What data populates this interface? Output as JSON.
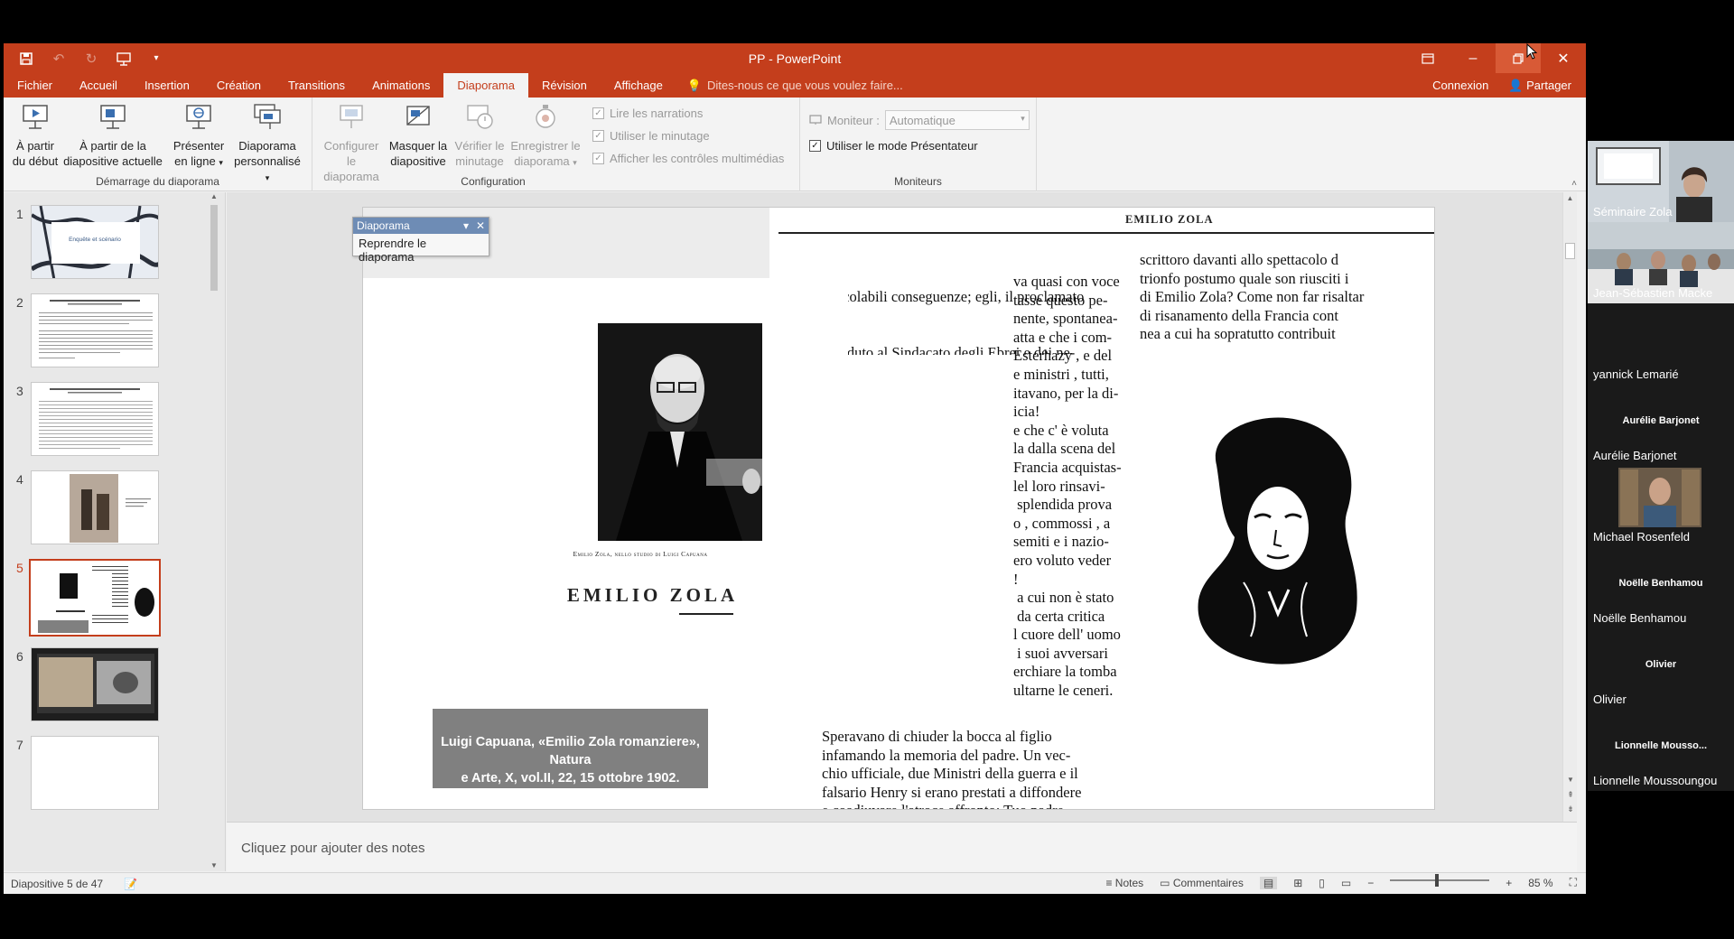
{
  "window": {
    "title": "PP - PowerPoint",
    "colors": {
      "accent": "#c43e1c",
      "ribbon_bg": "#f3f3f3",
      "call_bg": "#1a1a1a"
    }
  },
  "tabs": [
    "Fichier",
    "Accueil",
    "Insertion",
    "Création",
    "Transitions",
    "Animations",
    "Diaporama",
    "Révision",
    "Affichage"
  ],
  "active_tab": "Diaporama",
  "tell_me": "Dites-nous ce que vous voulez faire...",
  "account": {
    "signin": "Connexion",
    "share": "Partager"
  },
  "ribbon": {
    "start_group": {
      "label": "Démarrage du diaporama",
      "from_start": [
        "À partir",
        "du début"
      ],
      "from_current": [
        "À partir de la",
        "diapositive actuelle"
      ],
      "present_online": [
        "Présenter",
        "en ligne"
      ],
      "custom_show": [
        "Diaporama",
        "personnalisé"
      ]
    },
    "config_group": {
      "label": "Configuration",
      "setup": [
        "Configurer",
        "le diaporama"
      ],
      "hide_slide": [
        "Masquer la",
        "diapositive"
      ],
      "rehearse": [
        "Vérifier le",
        "minutage"
      ],
      "record": [
        "Enregistrer le",
        "diaporama"
      ],
      "play_narrations": "Lire les narrations",
      "use_timings": "Utiliser le minutage",
      "show_media_controls": "Afficher les contrôles multimédias"
    },
    "monitors_group": {
      "label": "Moniteurs",
      "monitor_label": "Moniteur :",
      "monitor_value": "Automatique",
      "presenter_view": "Utiliser le mode Présentateur"
    }
  },
  "floating_toolbar": {
    "title": "Diaporama",
    "item": "Reprendre le diaporama"
  },
  "thumbnails": [
    {
      "num": "1",
      "text": "Enquête et scénario"
    },
    {
      "num": "2",
      "text": ""
    },
    {
      "num": "3",
      "text": ""
    },
    {
      "num": "4",
      "text": ""
    },
    {
      "num": "5",
      "text": ""
    },
    {
      "num": "6",
      "text": ""
    },
    {
      "num": "7",
      "text": ""
    }
  ],
  "active_slide": "5",
  "slide": {
    "header": "EMILIO ZOLA",
    "portrait_caption": "Emilio Zola, nello studio di Luigi Capuana",
    "big_title": "EMILIO ZOLA",
    "caption_line1": "Luigi Capuana, «Emilio Zola romanziere», Natura",
    "caption_line2": "e Arte, X, vol.II, 22, 15 ottobre 1902.",
    "col_a_top": [
      "calcolabili conseguenze; egli, il proclamato",
      "venduto al Sindacato degli Ebrei e dei ne-"
    ],
    "col_a_right": [
      "va quasi con voce",
      "tasse questo pe-",
      "nente, spontanea-",
      "atta e che i com-",
      "Esterhazy , e del",
      "e ministri , tutti,",
      "itavano, per la di-",
      "icia!",
      "e che c' è voluta",
      "la dalla scena del",
      "Francia acquistas-",
      "lel loro rinsavi-",
      " splendida prova",
      "o , commossi , a",
      "semiti e i nazio-",
      "ero voluto veder",
      "!",
      " a cui non è stato",
      " da certa critica",
      "l cuore dell' uomo",
      " i suoi avversari",
      "erchiare la tomba",
      "ultarne le ceneri."
    ],
    "col_a_bottom": [
      "Speravano di chiuder la bocca al figlio",
      "infamando la memoria del padre. Un vec-",
      "chio ufficiale, due Ministri della guerra e il",
      "falsario Henry si erano prestati a diffondere",
      "e coadiuvare l'atroce affronto: Tuo padre"
    ],
    "col_b": [
      "scrittoro davanti allo spettacolo d",
      "trionfo postumo quale son riusciti i",
      "di Emilio Zola? Come non far risaltar",
      "di risanamento della Francia cont",
      "nea a cui ha sopratutto contribuit"
    ]
  },
  "notes_placeholder": "Cliquez pour ajouter des notes",
  "status": {
    "slide_info": "Diapositive 5 de 47",
    "notes": "Notes",
    "comments": "Commentaires",
    "zoom": "85 %"
  },
  "participants": [
    {
      "name": "Séminaire Zola",
      "has_video": true,
      "center_text": ""
    },
    {
      "name": "Jean-Sébastien Macke",
      "has_video": true,
      "center_text": ""
    },
    {
      "name": "yannick Lemarié",
      "has_video": false,
      "center_text": ""
    },
    {
      "name": "Aurélie Barjonet",
      "has_video": false,
      "center_text": "Aurélie Barjonet"
    },
    {
      "name": "Michael Rosenfeld",
      "has_video": true,
      "center_text": ""
    },
    {
      "name": "Noëlle Benhamou",
      "has_video": false,
      "center_text": "Noëlle Benhamou"
    },
    {
      "name": "Olivier",
      "has_video": false,
      "center_text": "Olivier"
    },
    {
      "name": "Lionnelle Moussoungou",
      "has_video": false,
      "center_text": "Lionnelle Mousso..."
    }
  ],
  "icons": [
    "save-icon",
    "undo-icon",
    "redo-icon",
    "start-from-beginning-icon",
    "qat-customize-icon",
    "ribbon-display-icon",
    "minimize-icon",
    "restore-icon",
    "close-icon",
    "lightbulb-icon",
    "person-icon",
    "mouse-cursor-icon"
  ]
}
